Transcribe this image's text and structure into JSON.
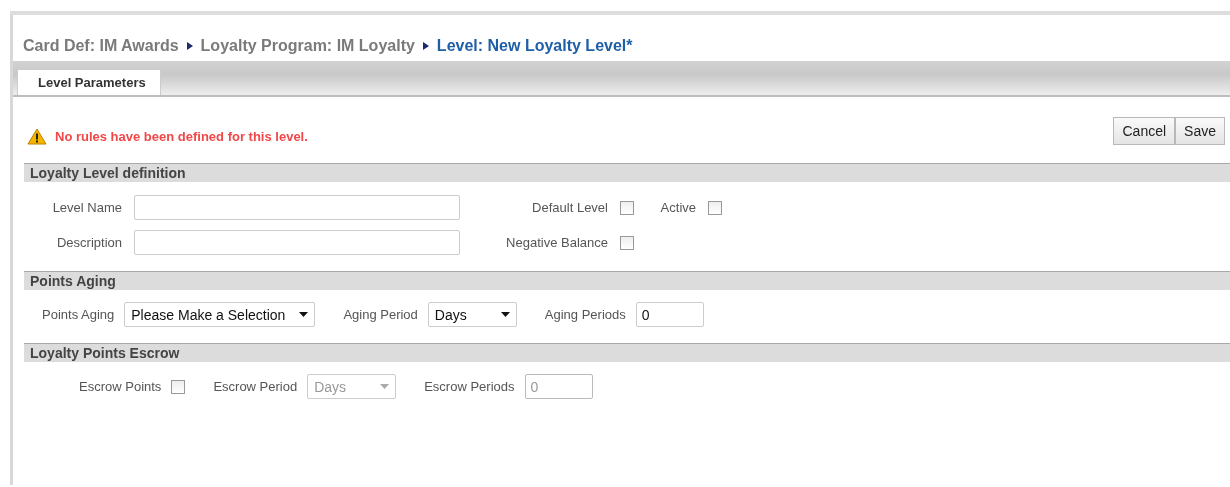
{
  "breadcrumb": [
    {
      "label": "Card Def: IM Awards",
      "current": false
    },
    {
      "label": "Loyalty Program: IM Loyalty",
      "current": false
    },
    {
      "label": "Level: New Loyalty Level*",
      "current": true
    }
  ],
  "tabs": [
    {
      "label": "Level Parameters",
      "selected": true
    }
  ],
  "warning": "No rules have been defined for this level.",
  "buttons": [
    "Cancel",
    "Save"
  ],
  "sections": [
    {
      "title": "Loyalty Level definition",
      "kind": "grid",
      "rows": [
        [
          {
            "kind": "text",
            "label": "Level Name"
          },
          {
            "kind": "checkbox",
            "label": "Default Level",
            "checked": false
          },
          {
            "kind": "checkbox",
            "label": "Active",
            "checked": false
          }
        ],
        [
          {
            "kind": "text",
            "label": "Description"
          },
          {
            "kind": "checkbox",
            "label": "Negative Balance",
            "checked": false
          }
        ]
      ]
    },
    {
      "title": "Points Aging",
      "kind": "flow",
      "rows": [
        [
          {
            "kind": "select",
            "label": "Points Aging",
            "value": "Please Make a Selection",
            "disabled": false
          },
          {
            "kind": "select",
            "label": "Aging Period",
            "value": "Days",
            "disabled": false
          },
          {
            "kind": "number",
            "label": "Aging Periods",
            "value": "0",
            "disabled": false
          }
        ]
      ]
    },
    {
      "title": "Loyalty Points Escrow",
      "kind": "indented",
      "rows": [
        [
          {
            "kind": "checkbox",
            "label": "Escrow Points",
            "checked": false
          },
          {
            "kind": "select",
            "label": "Escrow Period",
            "value": "Days",
            "disabled": true
          },
          {
            "kind": "number",
            "label": "Escrow Periods",
            "value": "0",
            "disabled": true
          }
        ]
      ]
    }
  ]
}
